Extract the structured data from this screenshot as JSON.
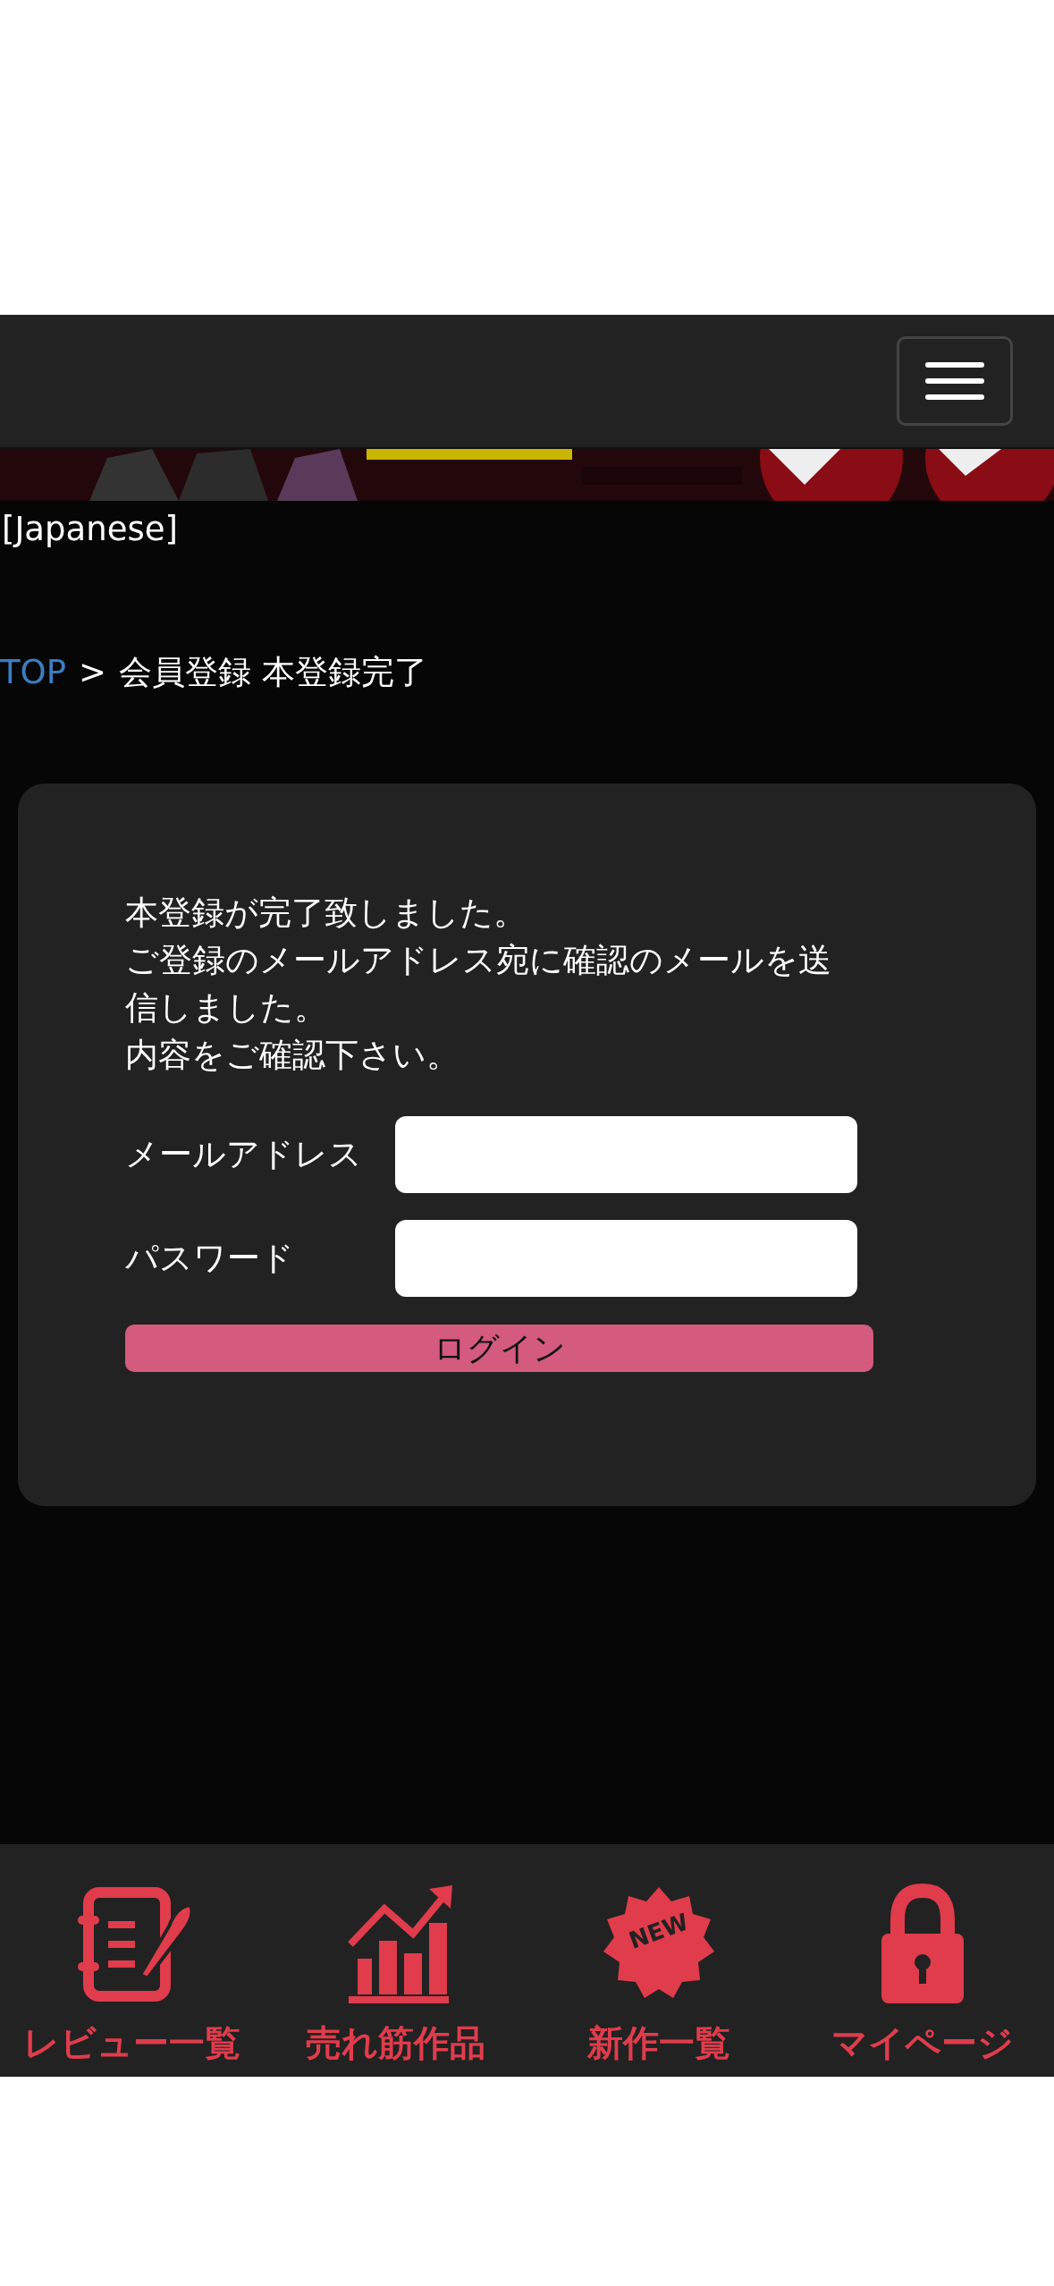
{
  "language_label": "[Japanese]",
  "breadcrumb": [
    {
      "label": "TOP",
      "kind": "link"
    },
    {
      "label": ">",
      "kind": "separator"
    },
    {
      "label": "会員登録 本登録完了",
      "kind": "current"
    }
  ],
  "message": [
    "本登録が完了致しました。",
    "ご登録のメールアドレス宛に確認のメールを送信しました。",
    "内容をご確認下さい。"
  ],
  "form": {
    "fields": [
      {
        "label": "メールアドレス"
      },
      {
        "label": "パスワード"
      }
    ],
    "submit": "ログイン"
  },
  "bottom_nav": [
    {
      "label": "レビュー一覧",
      "kind": "review"
    },
    {
      "label": "売れ筋作品",
      "kind": "chart"
    },
    {
      "label": "新作一覧",
      "kind": "new",
      "badge": "NEW"
    },
    {
      "label": "マイページ",
      "kind": "lock"
    }
  ]
}
